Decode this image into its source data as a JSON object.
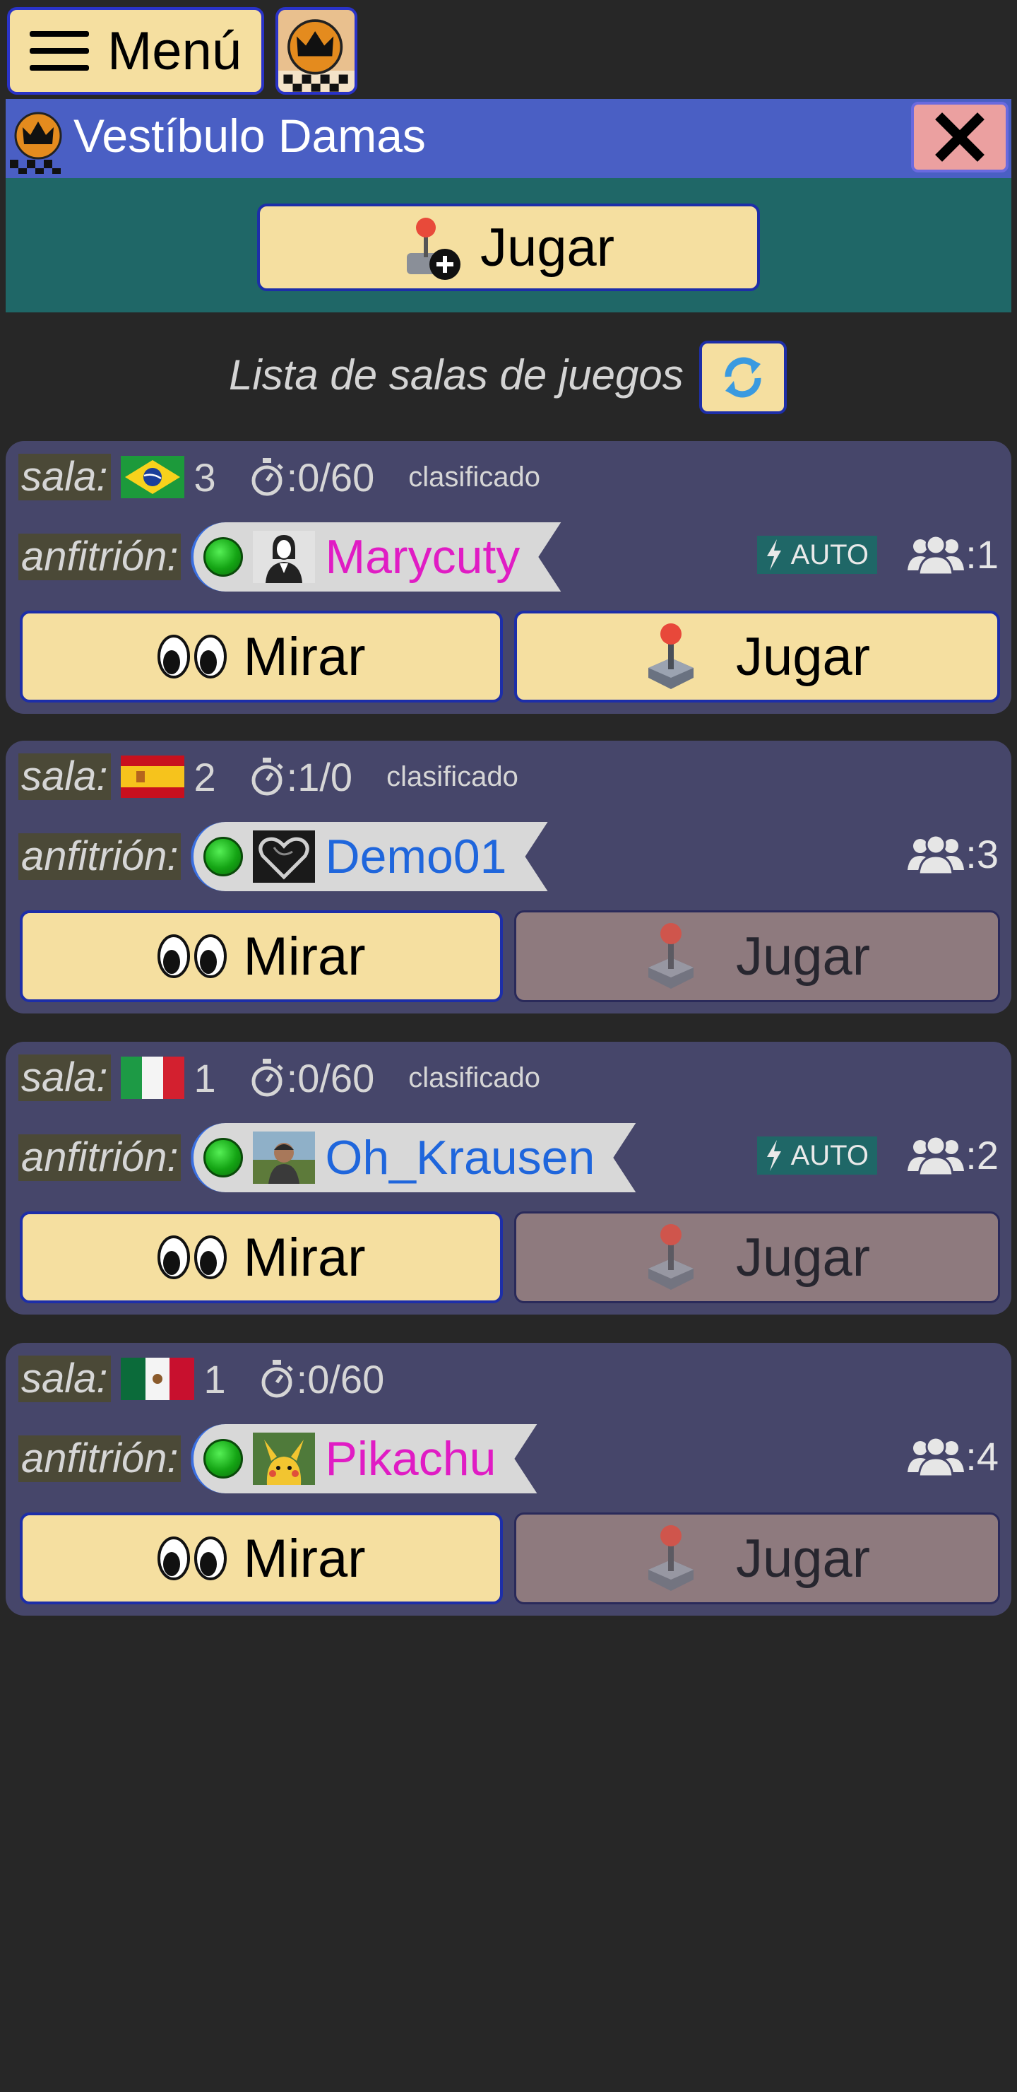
{
  "toolbar": {
    "menu_label": "Menú"
  },
  "lobby": {
    "title": "Vestíbulo Damas",
    "play_button_label": "Jugar"
  },
  "room_list": {
    "title": "Lista de salas de juegos"
  },
  "labels": {
    "room": "sala:",
    "host": "anfitrión:",
    "watch": "Mirar",
    "play": "Jugar",
    "auto": "AUTO"
  },
  "colors": {
    "background": "#272727",
    "lobby_header": "#4a5fc4",
    "play_area": "#1f6767",
    "card": "#46466a",
    "button": "#f5dfa0",
    "button_disabled": "#8e7a7e",
    "female_name": "#e01cc4",
    "male_name": "#1f66dc"
  },
  "rooms": [
    {
      "flag": "brazil-flag",
      "number": "3",
      "time": ":0/60",
      "ranked": "clasificado",
      "host": "Marycuty",
      "host_color": "female",
      "avatar": "woman-avatar",
      "auto": true,
      "viewers": ":1",
      "play_enabled": true
    },
    {
      "flag": "spain-flag",
      "number": "2",
      "time": ":1/0",
      "ranked": "clasificado",
      "host": "Demo01",
      "host_color": "male",
      "avatar": "heart-avatar",
      "auto": false,
      "viewers": ":3",
      "play_enabled": false
    },
    {
      "flag": "italy-flag",
      "number": "1",
      "time": ":0/60",
      "ranked": "clasificado",
      "host": "Oh_Krausen",
      "host_color": "male",
      "avatar": "photo-avatar",
      "auto": true,
      "viewers": ":2",
      "play_enabled": false
    },
    {
      "flag": "mexico-flag",
      "number": "1",
      "time": ":0/60",
      "ranked": "",
      "host": "Pikachu",
      "host_color": "female",
      "avatar": "pikachu-avatar",
      "auto": false,
      "viewers": ":4",
      "play_enabled": false
    }
  ]
}
